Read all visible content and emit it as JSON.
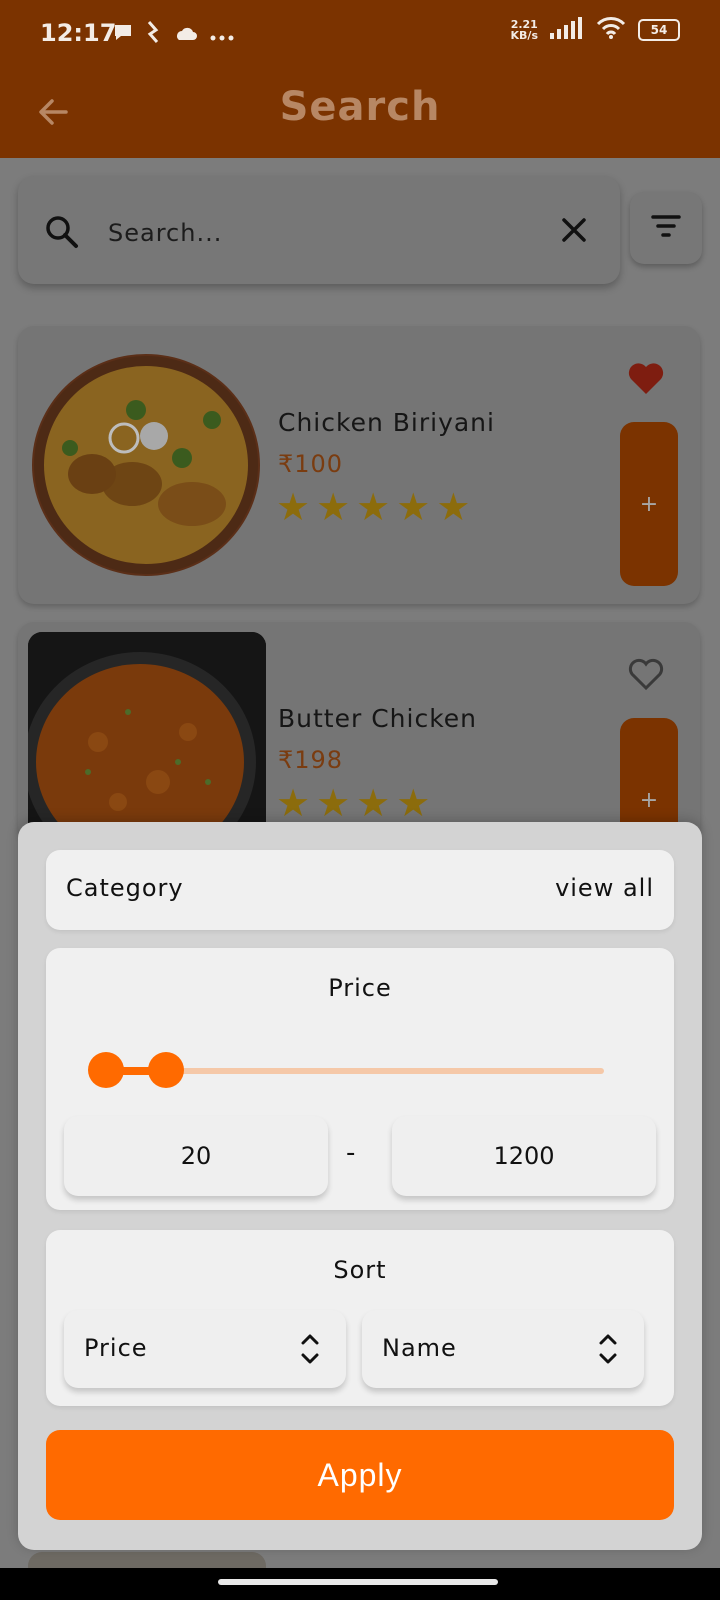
{
  "status_bar": {
    "time": "12:17",
    "net_speed_value": "2.21",
    "net_speed_unit": "KB/s",
    "battery": "54"
  },
  "app_bar": {
    "title": "Search"
  },
  "search": {
    "placeholder": "Search..."
  },
  "results": [
    {
      "name": "Chicken Biriyani",
      "price": "₹100",
      "rating": 5,
      "favorite": true,
      "add_label": "+"
    },
    {
      "name": "Butter Chicken",
      "price": "₹198",
      "rating": 4,
      "favorite": false,
      "add_label": "+"
    }
  ],
  "filter": {
    "category_label": "Category",
    "view_all_label": "view all",
    "price_title": "Price",
    "price_min": "20",
    "price_max": "1200",
    "range_separator": "-",
    "slider_low_fraction": 0.0,
    "slider_high_fraction": 0.12,
    "sort_title": "Sort",
    "sort_by_primary": "Price",
    "sort_by_secondary": "Name",
    "apply_label": "Apply"
  },
  "colors": {
    "brand": "#7b3300",
    "accent": "#ff6a00",
    "star": "#f5b301"
  }
}
